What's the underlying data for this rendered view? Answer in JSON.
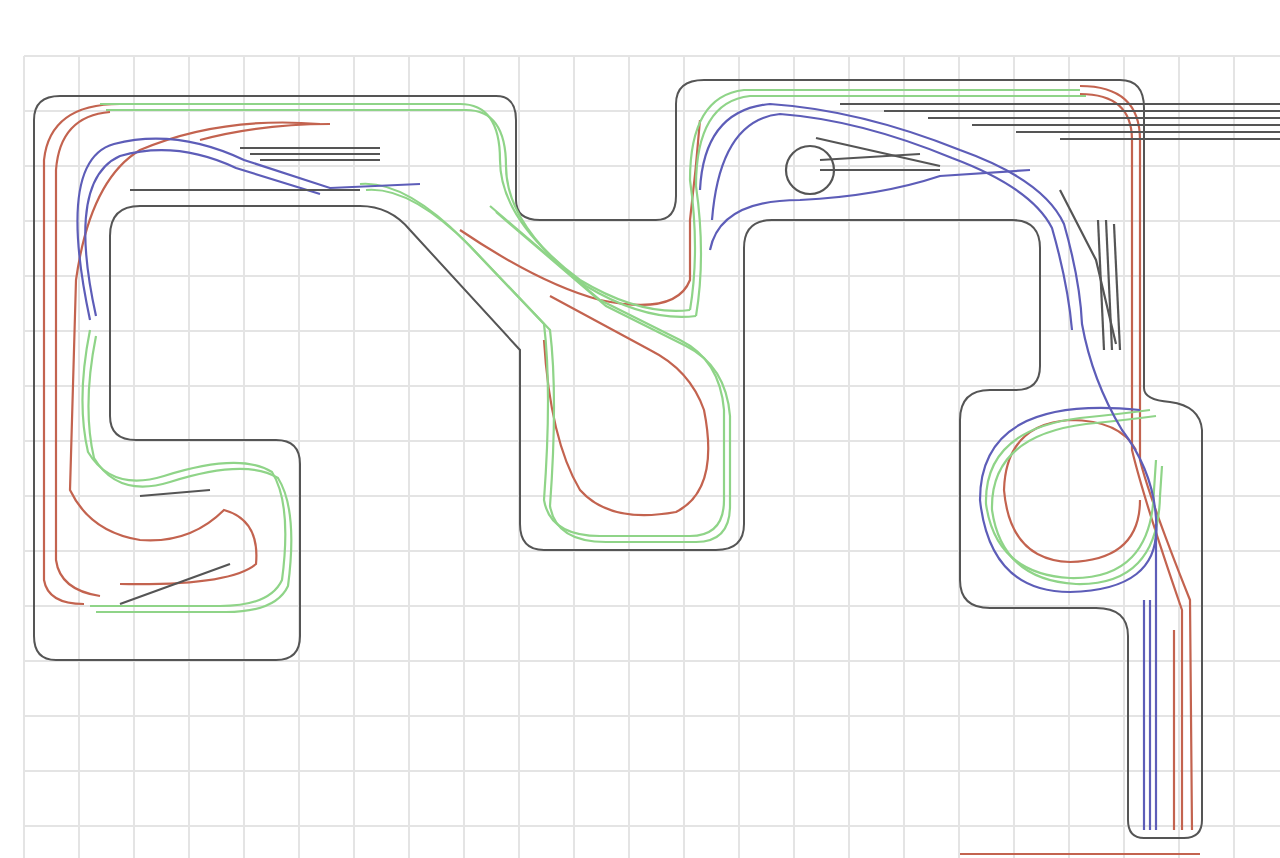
{
  "layers": [
    {
      "color": "#c3634f"
    },
    {
      "color": "#8fd488"
    },
    {
      "color": "#5d5db8"
    },
    {
      "color": "#555555"
    }
  ]
}
